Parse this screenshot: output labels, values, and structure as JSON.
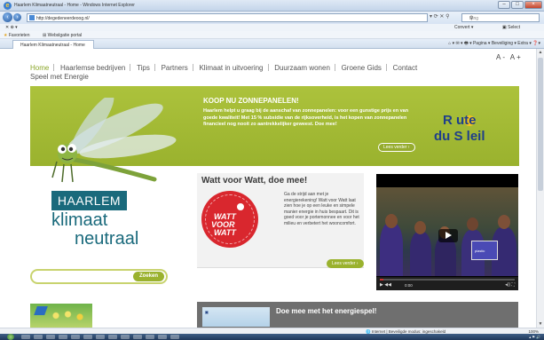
{
  "browser": {
    "window_title": "Haarlem Klimaatneutraal - Home - Windows Internet Explorer",
    "address": "http://degedeneerdeoog.nl/",
    "search_placeholder": "Bing",
    "menu": [
      "Bestand",
      "Bewerken",
      "Beeld",
      "Favorieten",
      "Extra",
      "Help"
    ],
    "favorites_label": "Favorieten",
    "suggested_sites": "Webslgatie portal",
    "tab_label": "Haarlem Klimaatneutraal - Home",
    "tab_tools": "Pagina ▾  Beveiliging ▾  Extra ▾",
    "convert_label": "Convert ▾"
  },
  "page": {
    "font_size_control": "A- A+",
    "nav": [
      "Home",
      "Haarlemse bedrijven",
      "Tips",
      "Partners",
      "Klimaat in uitvoering",
      "Duurzaam wonen",
      "Groene Gids",
      "Contact"
    ],
    "nav_line2": "Speel met Energie",
    "banner": {
      "heading": "KOOP NU ZONNEPANELEN!",
      "body": "Haarlem helpt u graag bij de aanschaf van zonnepanelen: voor een gunstige prijs en van goede kwaliteit! Met 15 % subsidie van de rijksoverheid, is het kopen van zonnepanelen financieel nog nooit zo aantrekkelijker geweest. Doe mee!",
      "read_more": "Lees verder",
      "route_line1": "R  ute",
      "route_line2": "du S  leil"
    },
    "logo": {
      "haarlem": "HAARLEM",
      "klimaat": "klimaat",
      "neutraal": "neutraal"
    },
    "search_button": "Zoeken",
    "watt": {
      "title": "Watt voor Watt, doe mee!",
      "logo_line1": "WATT",
      "logo_line2": "VOOR",
      "logo_line3": "WATT",
      "text": "Ga de strijd aan met je energierekening! Watt voor Watt laat zien hoe je op een leuke en simpele manier energie in huis bespaart. Dit is goed voor je portemonnee en voor het milieu en verbetert het wooncomfort.",
      "read_more": "Lees verder"
    },
    "video": {
      "time": "0:00",
      "sign_text": "plastic"
    },
    "energie": {
      "title": "Doe mee met het energiespel!"
    }
  },
  "statusbar": {
    "zone": "Internet | Beveiligde modus: ingeschakeld",
    "zoom": "100%"
  },
  "colors": {
    "accent_green": "#9ab22e",
    "logo_teal": "#1a6a7c",
    "watt_red": "#d9272e"
  }
}
